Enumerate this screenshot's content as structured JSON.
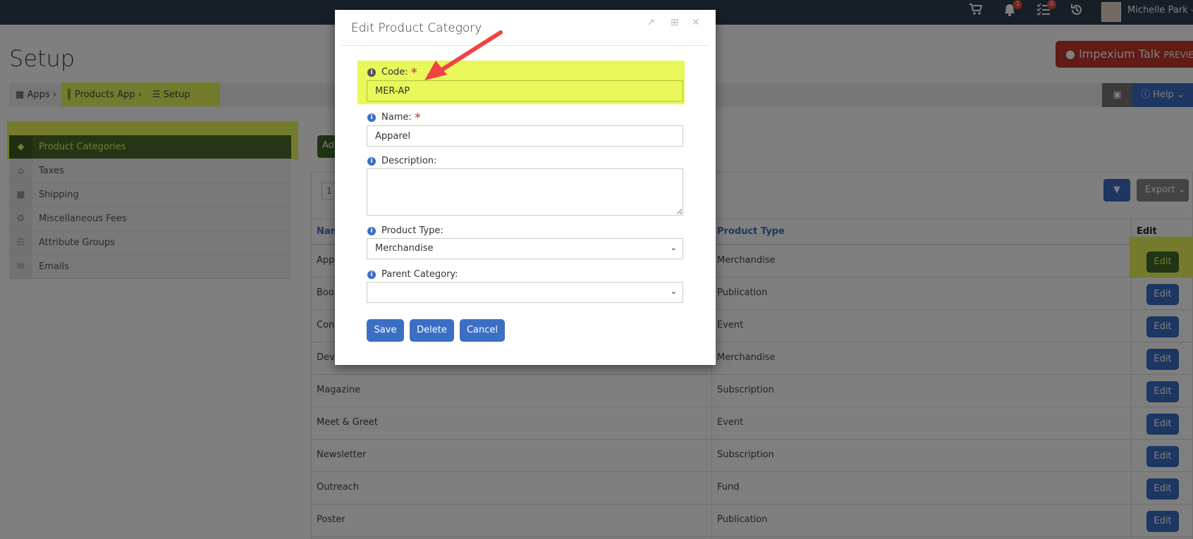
{
  "topbar": {
    "notifications_count": "1",
    "tasks_count": "0",
    "user_name": "Michelle Park"
  },
  "page": {
    "title": "Setup",
    "talk_button": "Impexium Talk",
    "talk_button_tag": "PREVIEW",
    "help_label": "Help"
  },
  "breadcrumb": {
    "items": [
      "Apps",
      "Products App",
      "Setup"
    ]
  },
  "sidebar": {
    "items": [
      {
        "label": "Product Categories",
        "icon": "tag-icon"
      },
      {
        "label": "Taxes",
        "icon": "bank-icon"
      },
      {
        "label": "Shipping",
        "icon": "truck-icon"
      },
      {
        "label": "Miscellaneous Fees",
        "icon": "recycle-icon"
      },
      {
        "label": "Attribute Groups",
        "icon": "list-icon"
      },
      {
        "label": "Emails",
        "icon": "envelope-icon"
      }
    ]
  },
  "table": {
    "add_label": "Ad",
    "page_size": "1",
    "export_label": "Export",
    "headers": [
      "Nam",
      "Product Type",
      "Edit"
    ],
    "rows": [
      {
        "name": "Appa",
        "type": "Merchandise"
      },
      {
        "name": "Bool",
        "type": "Publication"
      },
      {
        "name": "Conf",
        "type": "Event"
      },
      {
        "name": "Devi",
        "type": "Merchandise"
      },
      {
        "name": "Magazine",
        "type": "Subscription"
      },
      {
        "name": "Meet & Greet",
        "type": "Event"
      },
      {
        "name": "Newsletter",
        "type": "Subscription"
      },
      {
        "name": "Outreach",
        "type": "Fund"
      },
      {
        "name": "Poster",
        "type": "Publication"
      }
    ],
    "edit_label": "Edit"
  },
  "modal": {
    "title": "Edit Product Category",
    "code_label": "Code:",
    "code_value": "MER-AP",
    "name_label": "Name:",
    "name_value": "Apparel",
    "description_label": "Description:",
    "description_value": "",
    "product_type_label": "Product Type:",
    "product_type_value": "Merchandise",
    "parent_category_label": "Parent Category:",
    "parent_category_value": "",
    "save_label": "Save",
    "delete_label": "Delete",
    "cancel_label": "Cancel"
  },
  "colors": {
    "topbar": "#2c3e50",
    "primary": "#3a6fc4",
    "highlight": "#e8f75a",
    "active_green": "#4a6b2a",
    "talk_red": "#c0392b",
    "arrow": "#ef4444"
  }
}
